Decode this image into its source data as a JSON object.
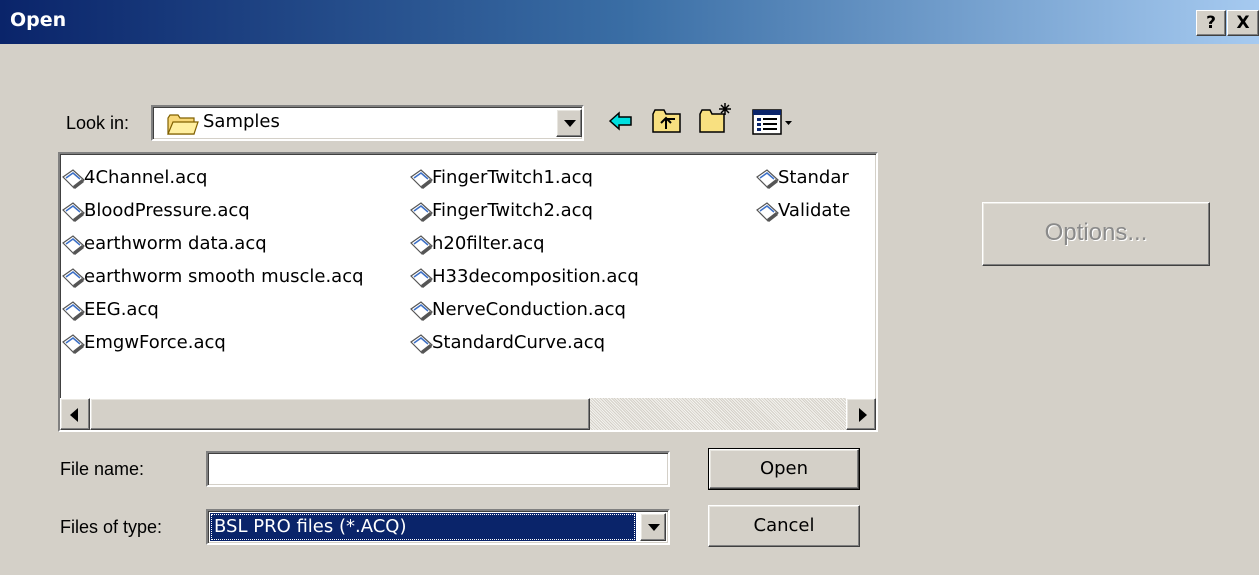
{
  "window": {
    "title": "Open",
    "help_button": "?",
    "close_button": "X"
  },
  "look_in": {
    "label": "Look in:",
    "value": "Samples",
    "folder_icon": "folder-icon",
    "toolbar": [
      {
        "name": "back-button",
        "icon": "arrow-left-icon"
      },
      {
        "name": "up-one-level-button",
        "icon": "folder-up-icon"
      },
      {
        "name": "create-new-folder-button",
        "icon": "new-folder-icon"
      },
      {
        "name": "view-menu-button",
        "icon": "view-list-icon"
      }
    ]
  },
  "files": {
    "column1": [
      "4Channel.acq",
      "BloodPressure.acq",
      "earthworm data.acq",
      "earthworm smooth muscle.acq",
      "EEG.acq",
      "EmgwForce.acq"
    ],
    "column2": [
      "FingerTwitch1.acq",
      "FingerTwitch2.acq",
      "h20filter.acq",
      "H33decomposition.acq",
      "NerveConduction.acq",
      "StandardCurve.acq"
    ],
    "column3": [
      "Standar",
      "Validate"
    ],
    "icon": "acq-file-icon"
  },
  "file_name": {
    "label": "File name:",
    "value": ""
  },
  "file_type": {
    "label": "Files of type:",
    "value": "BSL PRO files (*.ACQ)"
  },
  "buttons": {
    "open": "Open",
    "cancel": "Cancel",
    "options": "Options..."
  },
  "colors": {
    "title_gradient_start": "#0a246a",
    "title_gradient_end": "#a6caf0",
    "face": "#d4d0c8",
    "selection": "#0a246a",
    "disabled_text": "#8a8a8a"
  }
}
